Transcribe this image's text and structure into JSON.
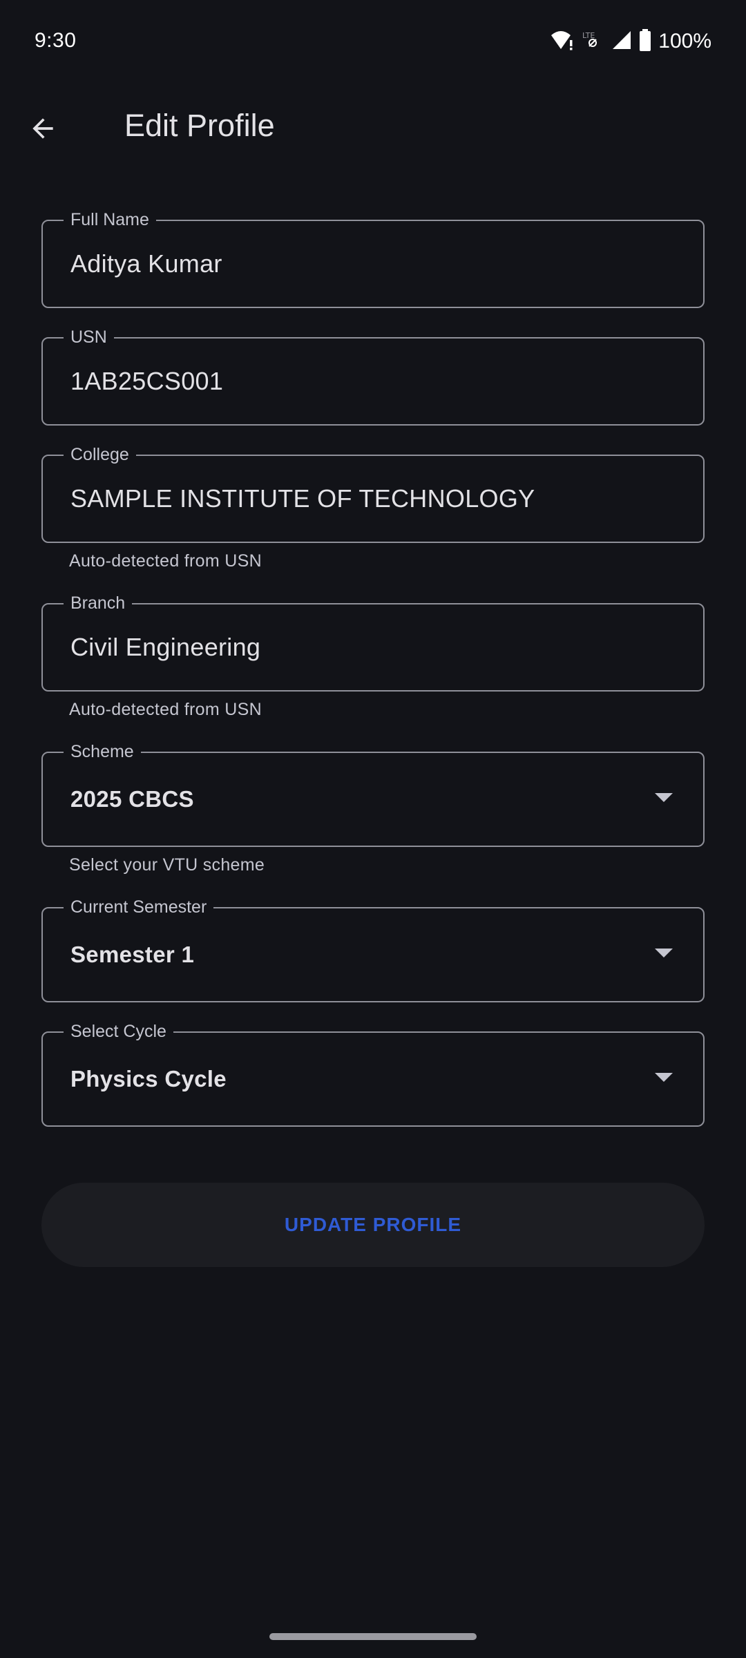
{
  "status_bar": {
    "time": "9:30",
    "battery_text": "100%",
    "icons": [
      "wifi-alert-icon",
      "lte-icon",
      "signal-icon",
      "battery-icon"
    ]
  },
  "app_bar": {
    "back_icon": "arrow-back-icon",
    "title": "Edit Profile"
  },
  "form": {
    "full_name": {
      "label": "Full Name",
      "value": "Aditya Kumar"
    },
    "usn": {
      "label": "USN",
      "value": "1AB25CS001"
    },
    "college": {
      "label": "College",
      "value": "SAMPLE INSTITUTE OF TECHNOLOGY",
      "helper": "Auto-detected from USN"
    },
    "branch": {
      "label": "Branch",
      "value": "Civil Engineering",
      "helper": "Auto-detected from USN"
    },
    "scheme": {
      "label": "Scheme",
      "value": "2025 CBCS",
      "helper": "Select your VTU scheme"
    },
    "semester": {
      "label": "Current Semester",
      "value": "Semester 1"
    },
    "cycle": {
      "label": "Select Cycle",
      "value": "Physics Cycle"
    }
  },
  "update_button": {
    "label": "UPDATE PROFILE"
  },
  "colors": {
    "background": "#121318",
    "outline": "#8f9099",
    "primary_text": "#e3e2e6",
    "accent": "#2f5bd4",
    "button_bg": "#1c1d22"
  }
}
